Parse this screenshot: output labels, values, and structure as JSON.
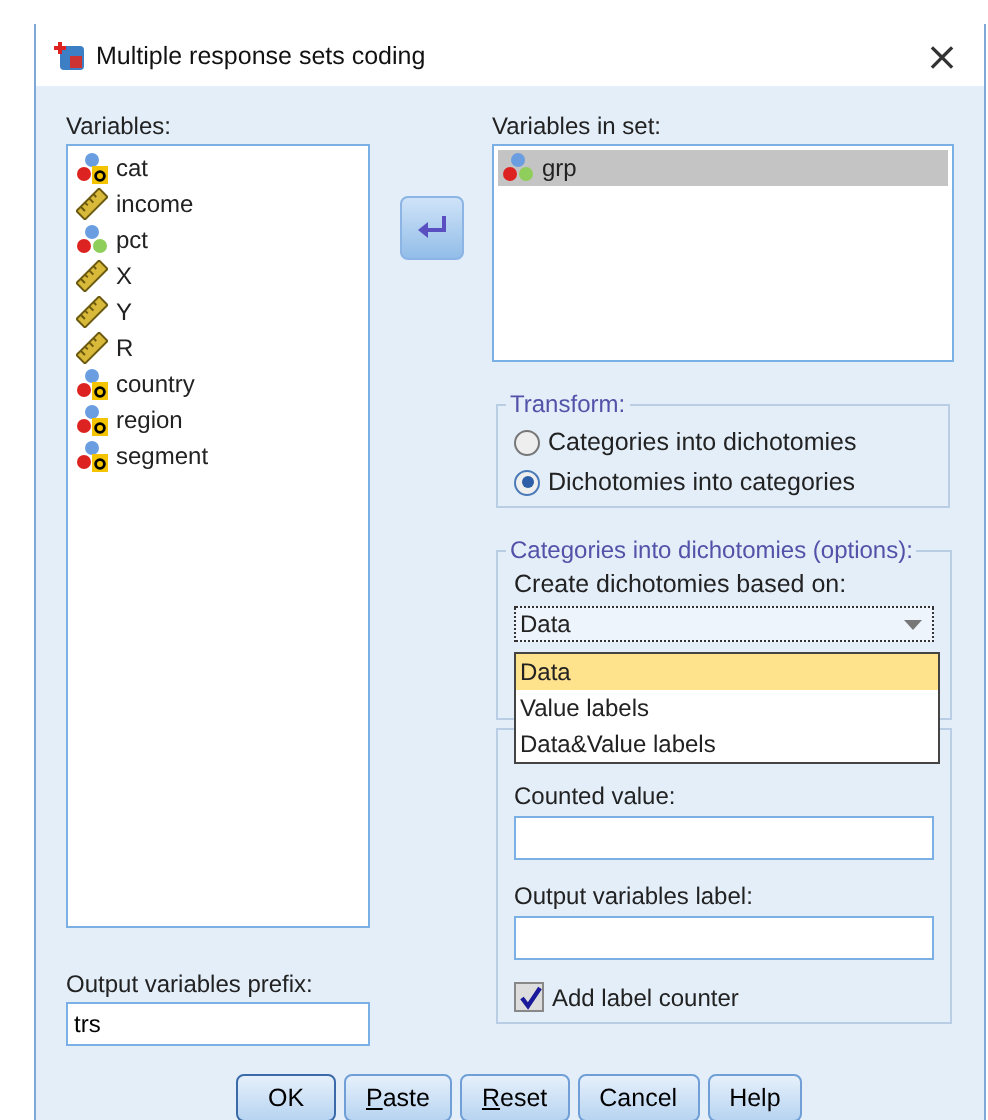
{
  "window": {
    "title": "Multiple response sets coding",
    "close": "×"
  },
  "variables": {
    "label": "Variables:",
    "items": [
      {
        "name": "cat",
        "kind": "string"
      },
      {
        "name": "income",
        "kind": "scale"
      },
      {
        "name": "pct",
        "kind": "set"
      },
      {
        "name": "X",
        "kind": "scale"
      },
      {
        "name": "Y",
        "kind": "scale"
      },
      {
        "name": "R",
        "kind": "scale"
      },
      {
        "name": "country",
        "kind": "string"
      },
      {
        "name": "region",
        "kind": "string"
      },
      {
        "name": "segment",
        "kind": "string"
      }
    ]
  },
  "variables_in_set": {
    "label": "Variables in set:",
    "items": [
      {
        "name": "grp",
        "kind": "set",
        "selected": true
      }
    ]
  },
  "output_prefix": {
    "label": "Output variables prefix:",
    "value": "trs"
  },
  "transform": {
    "title": "Transform:",
    "options": [
      {
        "label": "Categories into dichotomies",
        "selected": false
      },
      {
        "label": "Dichotomies into categories",
        "selected": true
      }
    ]
  },
  "options_group": {
    "title": "Categories into dichotomies (options):",
    "dropdown_label": "Create dichotomies based on:",
    "dropdown_value": "Data",
    "dropdown_open": true,
    "dropdown_items": [
      {
        "label": "Data",
        "selected": true
      },
      {
        "label": "Value labels",
        "selected": false
      },
      {
        "label": "Data&Value labels",
        "selected": false
      }
    ]
  },
  "counted_value": {
    "label": "Counted value:"
  },
  "output_label": {
    "label": "Output variables label:"
  },
  "add_label_counter": {
    "label": "Add label counter",
    "checked": true
  },
  "buttons": [
    {
      "label": "OK",
      "underline_first": false,
      "default": true
    },
    {
      "label": "Paste",
      "underline_first": true,
      "default": false
    },
    {
      "label": "Reset",
      "underline_first": true,
      "default": false
    },
    {
      "label": "Cancel",
      "underline_first": false,
      "default": false
    },
    {
      "label": "Help",
      "underline_first": false,
      "default": false
    }
  ]
}
